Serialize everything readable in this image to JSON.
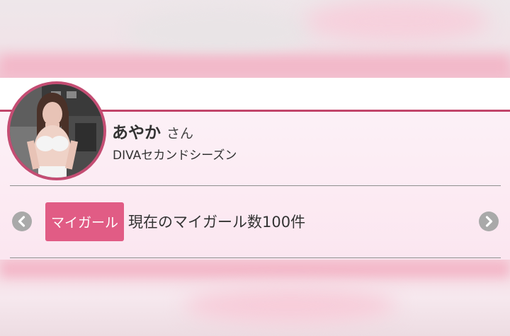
{
  "profile": {
    "name": "あやか",
    "honorific": "さん",
    "shop": "DIVAセカンドシーズン",
    "avatar_icon": "profile-photo"
  },
  "mygirl": {
    "badge_label": "マイガール",
    "count_text": "現在のマイガール数100件",
    "count": 100
  },
  "nav": {
    "prev_icon": "chevron-left-icon",
    "next_icon": "chevron-right-icon"
  },
  "colors": {
    "accent": "#c2456a",
    "badge": "#e15c85",
    "arrow": "#a9a9a9"
  }
}
